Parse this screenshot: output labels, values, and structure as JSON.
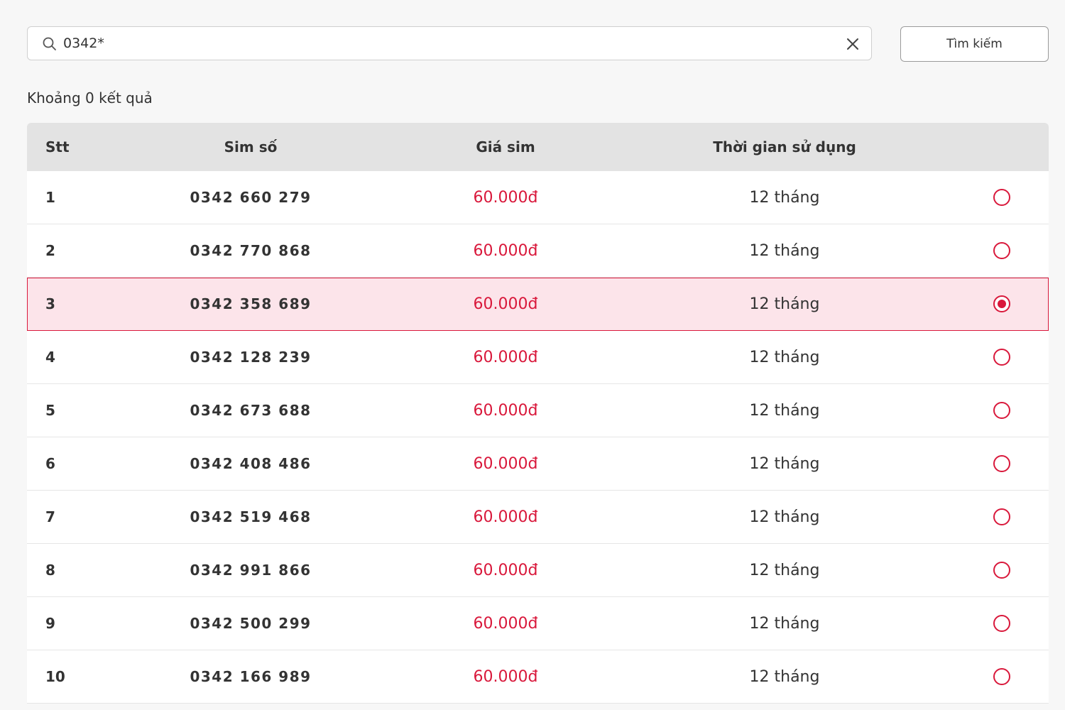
{
  "search": {
    "value": "0342*",
    "button_label": "Tìm kiếm"
  },
  "result_count": "Khoảng 0 kết quả",
  "table": {
    "headers": [
      "Stt",
      "Sim số",
      "Giá sim",
      "Thời gian sử dụng"
    ],
    "rows": [
      {
        "stt": "1",
        "sim": "0342 660 279",
        "price": "60.000đ",
        "time": "12 tháng",
        "selected": false
      },
      {
        "stt": "2",
        "sim": "0342 770 868",
        "price": "60.000đ",
        "time": "12 tháng",
        "selected": false
      },
      {
        "stt": "3",
        "sim": "0342 358 689",
        "price": "60.000đ",
        "time": "12 tháng",
        "selected": true
      },
      {
        "stt": "4",
        "sim": "0342 128 239",
        "price": "60.000đ",
        "time": "12 tháng",
        "selected": false
      },
      {
        "stt": "5",
        "sim": "0342 673 688",
        "price": "60.000đ",
        "time": "12 tháng",
        "selected": false
      },
      {
        "stt": "6",
        "sim": "0342 408 486",
        "price": "60.000đ",
        "time": "12 tháng",
        "selected": false
      },
      {
        "stt": "7",
        "sim": "0342 519 468",
        "price": "60.000đ",
        "time": "12 tháng",
        "selected": false
      },
      {
        "stt": "8",
        "sim": "0342 991 866",
        "price": "60.000đ",
        "time": "12 tháng",
        "selected": false
      },
      {
        "stt": "9",
        "sim": "0342 500 299",
        "price": "60.000đ",
        "time": "12 tháng",
        "selected": false
      },
      {
        "stt": "10",
        "sim": "0342 166 989",
        "price": "60.000đ",
        "time": "12 tháng",
        "selected": false
      }
    ]
  },
  "colors": {
    "accent": "#d9183b",
    "selected_row_bg": "#fce4ea",
    "header_bg": "#e3e3e3"
  },
  "icons": {
    "search": "search-icon",
    "clear": "close-icon"
  }
}
